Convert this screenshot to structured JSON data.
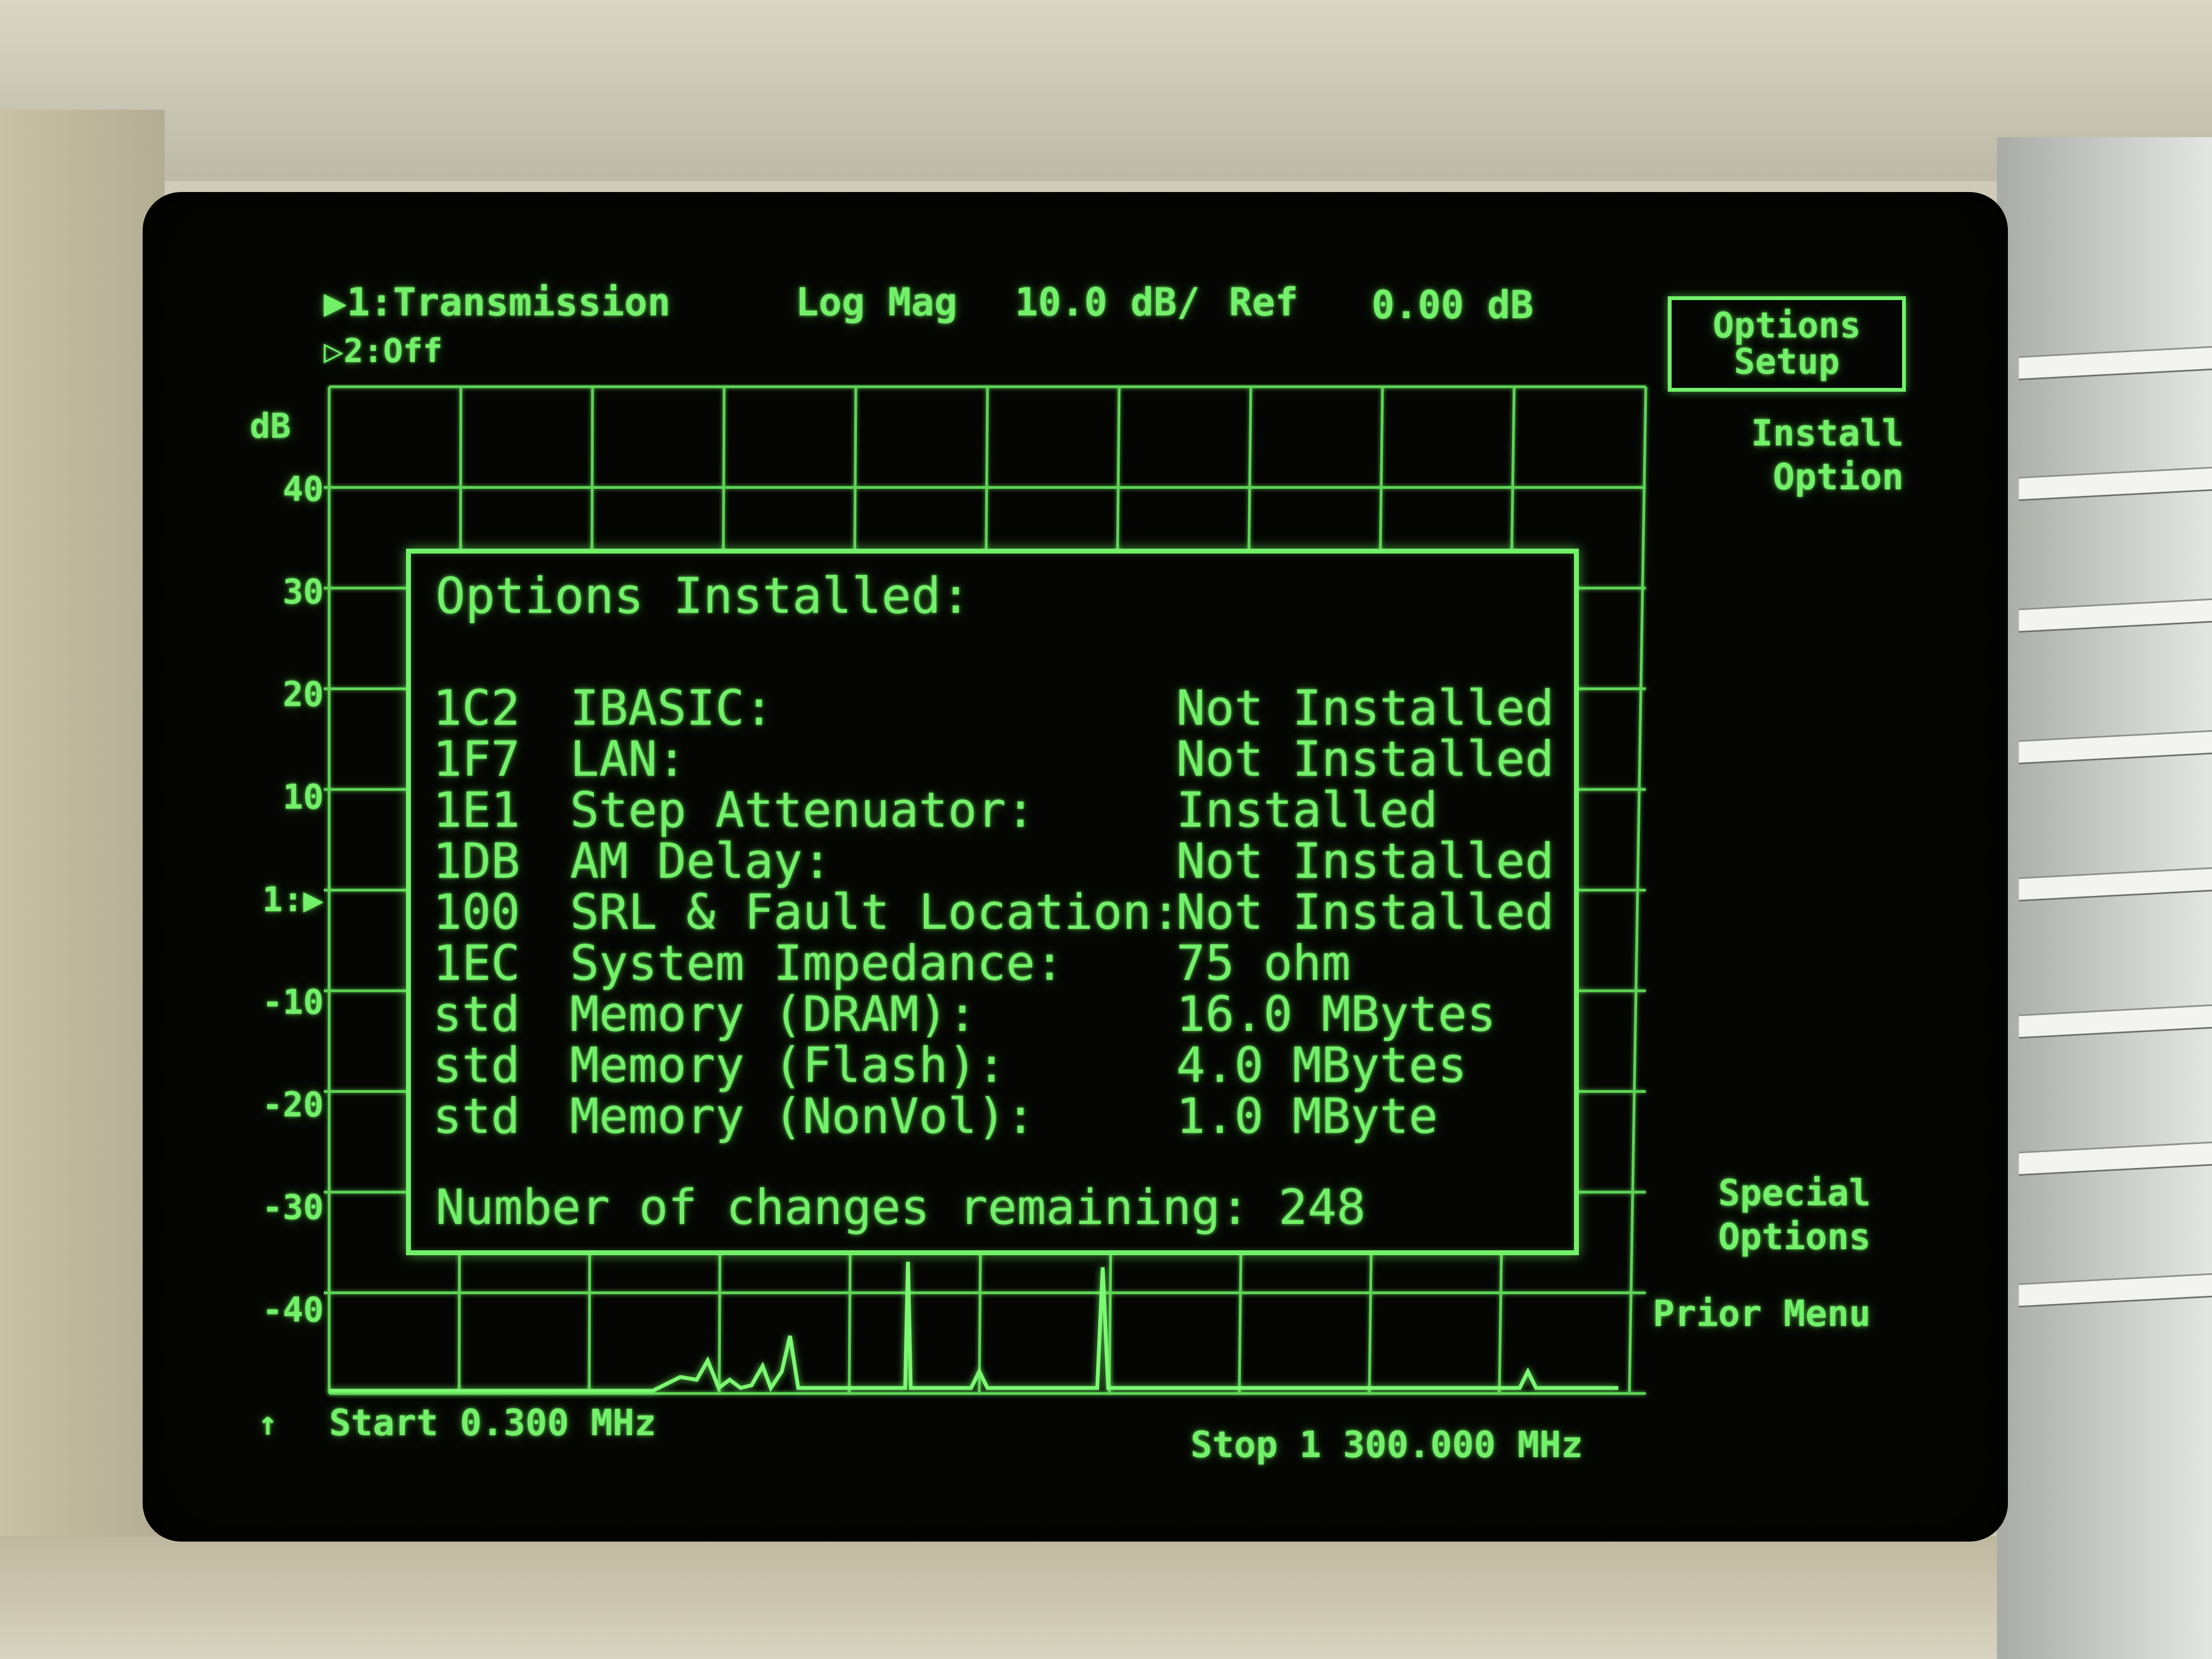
{
  "header": {
    "channel1": "▶1:Transmission",
    "channel2": "▷2:Off",
    "format": "Log Mag",
    "scale": "10.0 dB/",
    "ref_label": "Ref",
    "ref_value": "0.00 dB"
  },
  "axis": {
    "unit": "dB",
    "ticks": [
      "40",
      "30",
      "20",
      "10",
      "1:▶",
      "-10",
      "-20",
      "-30",
      "-40"
    ]
  },
  "footer": {
    "marker": "↑",
    "start": "Start 0.300 MHz",
    "stop": "Stop 1 300.000 MHz"
  },
  "softkeys": {
    "options_setup": [
      "Options",
      "Setup"
    ],
    "install_option": "Install\nOption",
    "special_options": "Special\nOptions",
    "prior_menu": "Prior Menu"
  },
  "dialog": {
    "title": "Options Installed:",
    "options": [
      {
        "code": "1C2",
        "name": "IBASIC:",
        "status": "Not Installed"
      },
      {
        "code": "1F7",
        "name": "LAN:",
        "status": "Not Installed"
      },
      {
        "code": "1E1",
        "name": "Step Attenuator:",
        "status": "Installed"
      },
      {
        "code": "1DB",
        "name": "AM Delay:",
        "status": "Not Installed"
      },
      {
        "code": "100",
        "name": "SRL & Fault Location:",
        "status": "Not Installed"
      },
      {
        "code": "1EC",
        "name": "System Impedance:",
        "status": "75 ohm"
      },
      {
        "code": "std",
        "name": "Memory (DRAM):",
        "status": "16.0 MBytes"
      },
      {
        "code": "std",
        "name": "Memory (Flash):",
        "status": "4.0 MBytes"
      },
      {
        "code": "std",
        "name": "Memory (NonVol):",
        "status": "1.0 MByte"
      }
    ],
    "footer": "Number of changes remaining: 248"
  },
  "colors": {
    "phosphor": "#73f06a",
    "screen_bg": "#050603",
    "bezel": "#cfcbb8"
  }
}
